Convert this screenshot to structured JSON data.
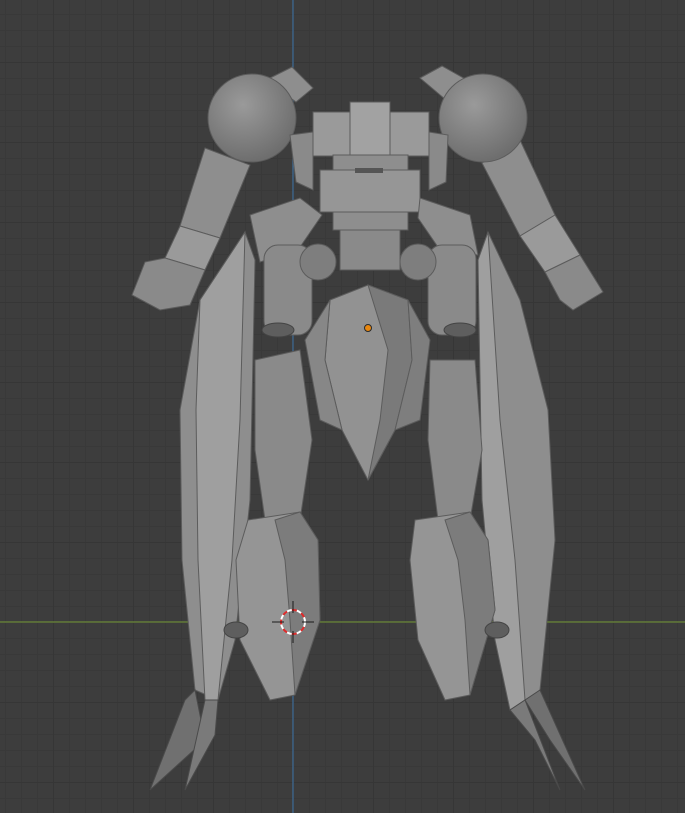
{
  "viewport": {
    "background": "#3d3d3d",
    "grid_color": "#363636",
    "x_axis_color": "#6d8a3a",
    "y_axis_color": "#3f6d9a"
  },
  "model": {
    "material_color": "#8e8e8e",
    "highlight_color": "#a8a8a8",
    "shadow_color": "#6a6a6a"
  },
  "origin_marker": {
    "color": "#e8870f"
  },
  "cursor_3d": {
    "colors": [
      "#e02b2b",
      "#ffffff"
    ]
  }
}
